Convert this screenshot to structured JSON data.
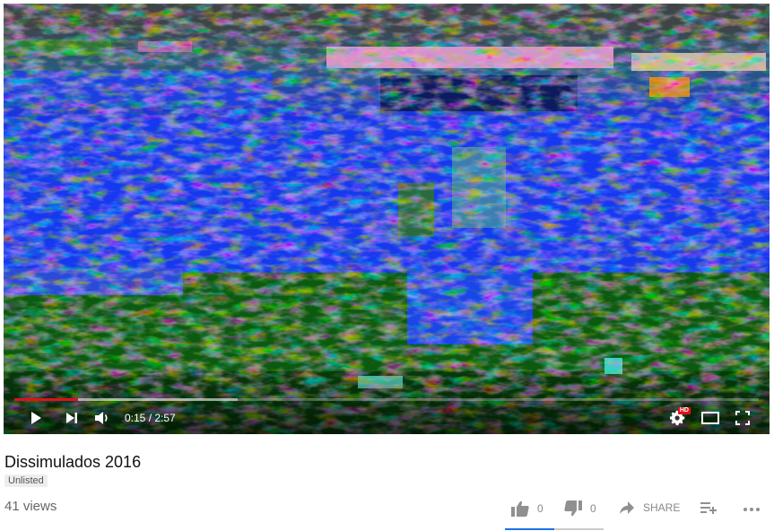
{
  "player": {
    "progress_played": 0.085,
    "progress_loaded": 0.3,
    "time_current": "0:15",
    "time_total": "2:57",
    "time_separator": " / ",
    "quality_badge": "HD",
    "icons": [
      "play-icon",
      "next-icon",
      "volume-icon",
      "settings-icon",
      "theater-mode-icon",
      "fullscreen-icon"
    ]
  },
  "video": {
    "title": "Dissimulados 2016",
    "privacy_badge": "Unlisted",
    "views": "41 views"
  },
  "actions": {
    "like_count": "0",
    "dislike_count": "0",
    "share_label": "SHARE"
  },
  "colors": {
    "accent": "#e1101c",
    "sentiment_like": "#1a73e8",
    "sentiment_dislike": "#cccccc"
  }
}
